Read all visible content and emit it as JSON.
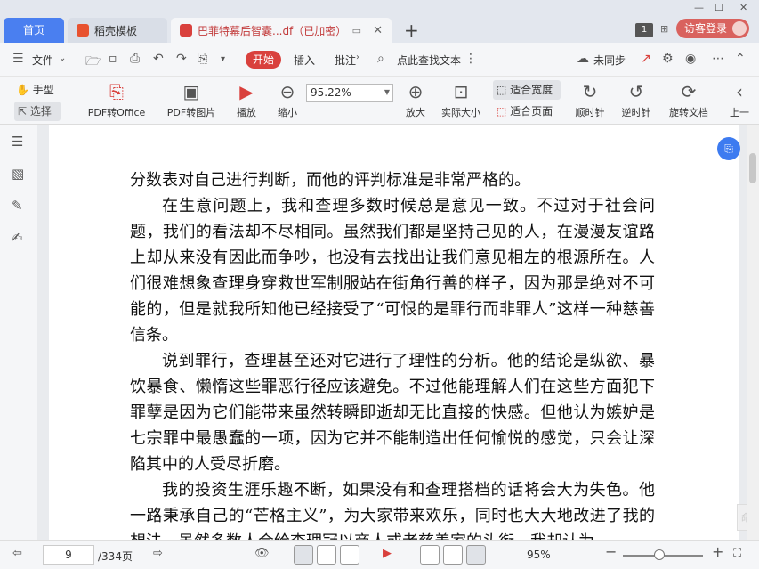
{
  "tabs": {
    "home": "首页",
    "template": "稻壳模板",
    "doc": "巴菲特幕后智囊...df（已加密）",
    "page_badge": "1",
    "login": "访客登录"
  },
  "menu": {
    "file": "文件",
    "start": "开始",
    "insert": "插入",
    "annotate": "批注",
    "search": "点此查找文本",
    "sync": "未同步"
  },
  "ribbon": {
    "hand": "手型",
    "select": "选择",
    "pdf_office": "PDF转Office",
    "pdf_image": "PDF转图片",
    "play": "播放",
    "zoom_out": "缩小",
    "zoom_value": "95.22%",
    "zoom_in": "放大",
    "actual_size": "实际大小",
    "fit_width": "适合宽度",
    "fit_page": "适合页面",
    "rotate_cw": "顺时针",
    "rotate_ccw": "逆时针",
    "rotate_doc": "旋转文档",
    "prev": "上一"
  },
  "document": {
    "paragraphs": [
      {
        "indent": false,
        "text": "分数表对自己进行判断，而他的评判标准是非常严格的。"
      },
      {
        "indent": true,
        "text": "在生意问题上，我和查理多数时候总是意见一致。不过对于社会问题，我们的看法却不尽相同。虽然我们都是坚持己见的人，在漫漫友谊路上却从来没有因此而争吵，也没有去找出让我们意见相左的根源所在。人们很难想象查理身穿救世军制服站在街角行善的样子，因为那是绝对不可能的，但是就我所知他已经接受了“可恨的是罪行而非罪人”这样一种慈善信条。"
      },
      {
        "indent": true,
        "text": "说到罪行，查理甚至还对它进行了理性的分析。他的结论是纵欲、暴饮暴食、懒惰这些罪恶行径应该避免。不过他能理解人们在这些方面犯下罪孽是因为它们能带来虽然转瞬即逝却无比直接的快感。但他认为嫉妒是七宗罪中最愚蠢的一项，因为它并不能制造出任何愉悦的感觉，只会让深陷其中的人受尽折磨。"
      },
      {
        "indent": true,
        "text": "我的投资生涯乐趣不断，如果没有和查理搭档的话将会大为失色。他一路秉承自己的“芒格主义”，为大家带来欢乐，同时也大大地改进了我的想法。虽然多数人会给查理冠以商人或者慈善家的头衔，我却认为"
      }
    ],
    "ghost_button": "命令栏"
  },
  "status": {
    "current_page": "9",
    "total_pages": "/334页",
    "zoom": "95%"
  }
}
